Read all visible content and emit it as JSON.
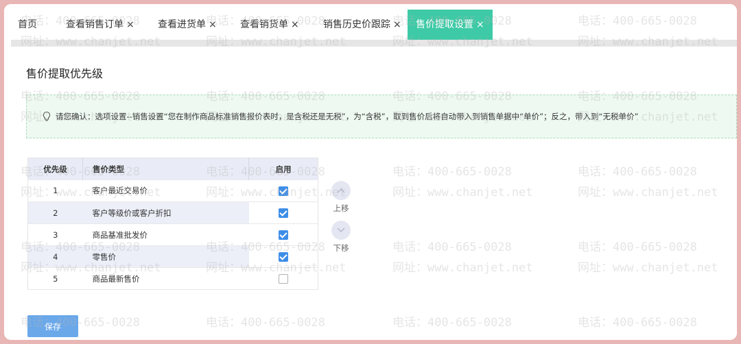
{
  "tabs": [
    {
      "label": "首页",
      "closable": false,
      "active": false
    },
    {
      "label": "查看销售订单",
      "closable": true,
      "active": false
    },
    {
      "label": "查看进货单",
      "closable": true,
      "active": false
    },
    {
      "label": "查看销货单",
      "closable": true,
      "active": false
    },
    {
      "label": "销售历史价跟踪",
      "closable": true,
      "active": false
    },
    {
      "label": "售价提取设置",
      "closable": true,
      "active": true
    }
  ],
  "close_glyph": "×",
  "page": {
    "title": "售价提取优先级",
    "notice": "请您确认：选项设置--销售设置“您在制作商品标准销售报价表时，是含税还是无税”，为“含税”，取到售价后将自动带入到销售单据中“单价”；反之，带入到“无税单价”"
  },
  "table": {
    "headers": {
      "priority": "优先级",
      "type": "售价类型",
      "enabled": "启用"
    },
    "rows": [
      {
        "priority": "1",
        "type": "客户最近交易价",
        "enabled": true
      },
      {
        "priority": "2",
        "type": "客户等级价或客户折扣",
        "enabled": true
      },
      {
        "priority": "3",
        "type": "商品基准批发价",
        "enabled": true
      },
      {
        "priority": "4",
        "type": "零售价",
        "enabled": true
      },
      {
        "priority": "5",
        "type": "商品最新售价",
        "enabled": false
      }
    ]
  },
  "move": {
    "up_label": "上移",
    "down_label": "下移"
  },
  "save_label": "保存",
  "watermark": {
    "phone": "电话：400-665-0028",
    "site": "网址：www.chanjet.net"
  },
  "colors": {
    "active_tab": "#3ecaa6",
    "checkbox": "#3e8ee8",
    "save": "#6aa8ea",
    "notice_bg": "#eef9f1"
  }
}
